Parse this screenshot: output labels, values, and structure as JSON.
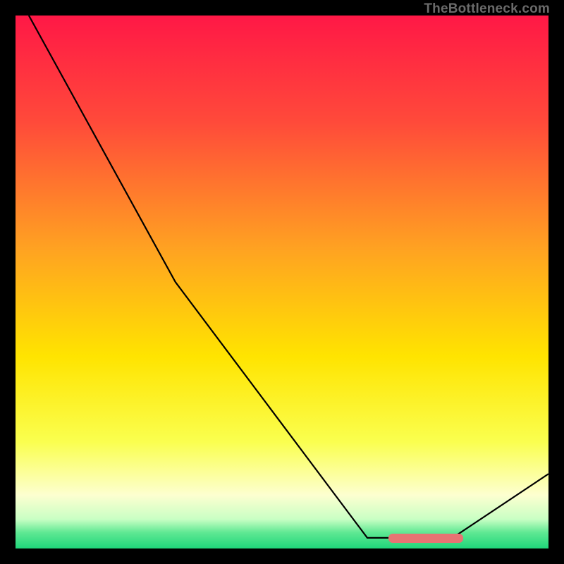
{
  "watermark": "TheBottleneck.com",
  "chart_data": {
    "type": "line",
    "title": "",
    "xlabel": "",
    "ylabel": "",
    "xlim": [
      0,
      100
    ],
    "ylim": [
      0,
      100
    ],
    "series": [
      {
        "name": "bottleneck-curve",
        "x": [
          2.5,
          30,
          66,
          82,
          100
        ],
        "y": [
          100,
          50,
          2,
          2,
          14
        ]
      }
    ],
    "highlight_segment": {
      "x_start": 70,
      "x_end": 84,
      "y": 2
    },
    "background_gradient": {
      "stops": [
        {
          "pos": 0.0,
          "color": "#ff1846"
        },
        {
          "pos": 0.2,
          "color": "#ff4a3a"
        },
        {
          "pos": 0.44,
          "color": "#ffa321"
        },
        {
          "pos": 0.64,
          "color": "#ffe400"
        },
        {
          "pos": 0.8,
          "color": "#faff4f"
        },
        {
          "pos": 0.9,
          "color": "#fdffd0"
        },
        {
          "pos": 0.945,
          "color": "#c9ffc4"
        },
        {
          "pos": 0.97,
          "color": "#5fe893"
        },
        {
          "pos": 1.0,
          "color": "#1fd67a"
        }
      ]
    }
  }
}
